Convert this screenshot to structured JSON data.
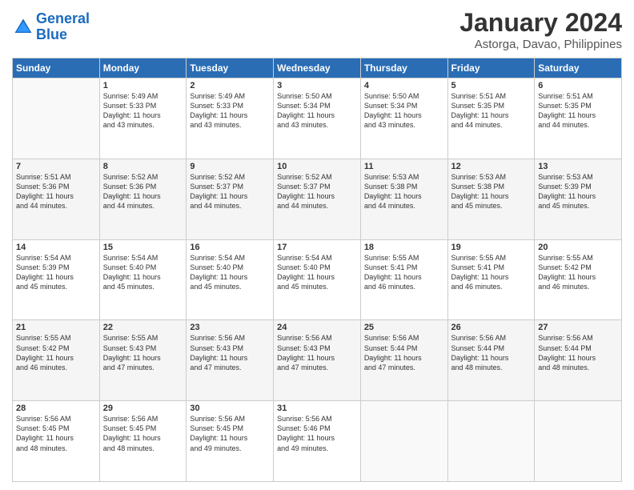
{
  "logo": {
    "line1": "General",
    "line2": "Blue"
  },
  "title": "January 2024",
  "subtitle": "Astorga, Davao, Philippines",
  "days_of_week": [
    "Sunday",
    "Monday",
    "Tuesday",
    "Wednesday",
    "Thursday",
    "Friday",
    "Saturday"
  ],
  "weeks": [
    [
      {
        "day": "",
        "detail": ""
      },
      {
        "day": "1",
        "detail": "Sunrise: 5:49 AM\nSunset: 5:33 PM\nDaylight: 11 hours\nand 43 minutes."
      },
      {
        "day": "2",
        "detail": "Sunrise: 5:49 AM\nSunset: 5:33 PM\nDaylight: 11 hours\nand 43 minutes."
      },
      {
        "day": "3",
        "detail": "Sunrise: 5:50 AM\nSunset: 5:34 PM\nDaylight: 11 hours\nand 43 minutes."
      },
      {
        "day": "4",
        "detail": "Sunrise: 5:50 AM\nSunset: 5:34 PM\nDaylight: 11 hours\nand 43 minutes."
      },
      {
        "day": "5",
        "detail": "Sunrise: 5:51 AM\nSunset: 5:35 PM\nDaylight: 11 hours\nand 44 minutes."
      },
      {
        "day": "6",
        "detail": "Sunrise: 5:51 AM\nSunset: 5:35 PM\nDaylight: 11 hours\nand 44 minutes."
      }
    ],
    [
      {
        "day": "7",
        "detail": "Sunrise: 5:51 AM\nSunset: 5:36 PM\nDaylight: 11 hours\nand 44 minutes."
      },
      {
        "day": "8",
        "detail": "Sunrise: 5:52 AM\nSunset: 5:36 PM\nDaylight: 11 hours\nand 44 minutes."
      },
      {
        "day": "9",
        "detail": "Sunrise: 5:52 AM\nSunset: 5:37 PM\nDaylight: 11 hours\nand 44 minutes."
      },
      {
        "day": "10",
        "detail": "Sunrise: 5:52 AM\nSunset: 5:37 PM\nDaylight: 11 hours\nand 44 minutes."
      },
      {
        "day": "11",
        "detail": "Sunrise: 5:53 AM\nSunset: 5:38 PM\nDaylight: 11 hours\nand 44 minutes."
      },
      {
        "day": "12",
        "detail": "Sunrise: 5:53 AM\nSunset: 5:38 PM\nDaylight: 11 hours\nand 45 minutes."
      },
      {
        "day": "13",
        "detail": "Sunrise: 5:53 AM\nSunset: 5:39 PM\nDaylight: 11 hours\nand 45 minutes."
      }
    ],
    [
      {
        "day": "14",
        "detail": "Sunrise: 5:54 AM\nSunset: 5:39 PM\nDaylight: 11 hours\nand 45 minutes."
      },
      {
        "day": "15",
        "detail": "Sunrise: 5:54 AM\nSunset: 5:40 PM\nDaylight: 11 hours\nand 45 minutes."
      },
      {
        "day": "16",
        "detail": "Sunrise: 5:54 AM\nSunset: 5:40 PM\nDaylight: 11 hours\nand 45 minutes."
      },
      {
        "day": "17",
        "detail": "Sunrise: 5:54 AM\nSunset: 5:40 PM\nDaylight: 11 hours\nand 45 minutes."
      },
      {
        "day": "18",
        "detail": "Sunrise: 5:55 AM\nSunset: 5:41 PM\nDaylight: 11 hours\nand 46 minutes."
      },
      {
        "day": "19",
        "detail": "Sunrise: 5:55 AM\nSunset: 5:41 PM\nDaylight: 11 hours\nand 46 minutes."
      },
      {
        "day": "20",
        "detail": "Sunrise: 5:55 AM\nSunset: 5:42 PM\nDaylight: 11 hours\nand 46 minutes."
      }
    ],
    [
      {
        "day": "21",
        "detail": "Sunrise: 5:55 AM\nSunset: 5:42 PM\nDaylight: 11 hours\nand 46 minutes."
      },
      {
        "day": "22",
        "detail": "Sunrise: 5:55 AM\nSunset: 5:43 PM\nDaylight: 11 hours\nand 47 minutes."
      },
      {
        "day": "23",
        "detail": "Sunrise: 5:56 AM\nSunset: 5:43 PM\nDaylight: 11 hours\nand 47 minutes."
      },
      {
        "day": "24",
        "detail": "Sunrise: 5:56 AM\nSunset: 5:43 PM\nDaylight: 11 hours\nand 47 minutes."
      },
      {
        "day": "25",
        "detail": "Sunrise: 5:56 AM\nSunset: 5:44 PM\nDaylight: 11 hours\nand 47 minutes."
      },
      {
        "day": "26",
        "detail": "Sunrise: 5:56 AM\nSunset: 5:44 PM\nDaylight: 11 hours\nand 48 minutes."
      },
      {
        "day": "27",
        "detail": "Sunrise: 5:56 AM\nSunset: 5:44 PM\nDaylight: 11 hours\nand 48 minutes."
      }
    ],
    [
      {
        "day": "28",
        "detail": "Sunrise: 5:56 AM\nSunset: 5:45 PM\nDaylight: 11 hours\nand 48 minutes."
      },
      {
        "day": "29",
        "detail": "Sunrise: 5:56 AM\nSunset: 5:45 PM\nDaylight: 11 hours\nand 48 minutes."
      },
      {
        "day": "30",
        "detail": "Sunrise: 5:56 AM\nSunset: 5:45 PM\nDaylight: 11 hours\nand 49 minutes."
      },
      {
        "day": "31",
        "detail": "Sunrise: 5:56 AM\nSunset: 5:46 PM\nDaylight: 11 hours\nand 49 minutes."
      },
      {
        "day": "",
        "detail": ""
      },
      {
        "day": "",
        "detail": ""
      },
      {
        "day": "",
        "detail": ""
      }
    ]
  ]
}
